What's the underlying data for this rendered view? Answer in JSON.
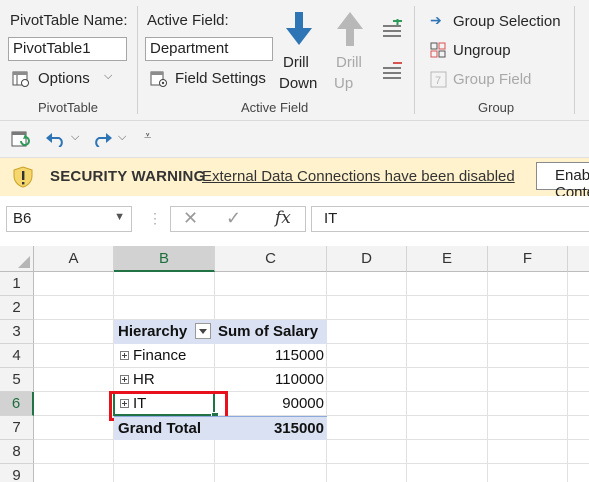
{
  "ribbon": {
    "pivot_name_label": "PivotTable Name:",
    "pivot_name_value": "PivotTable1",
    "options_label": "Options",
    "group_pivot_label": "PivotTable",
    "active_field_label": "Active Field:",
    "active_field_value": "Department",
    "field_settings_label": "Field Settings",
    "drill_down_line1": "Drill",
    "drill_down_line2": "Down",
    "drill_up_line1": "Drill",
    "drill_up_line2": "Up",
    "group_active_label": "Active Field",
    "group_selection_label": "Group Selection",
    "ungroup_label": "Ungroup",
    "group_field_label": "Group Field",
    "group_group_label": "Group"
  },
  "security": {
    "title": "SECURITY WARNING",
    "message": "External Data Connections have been disabled",
    "enable_label": "Enable Content"
  },
  "formula_bar": {
    "name_box": "B6",
    "fx_label": "fx",
    "value": "IT"
  },
  "grid": {
    "columns": [
      "A",
      "B",
      "C",
      "D",
      "E",
      "F"
    ],
    "rows": [
      "1",
      "2",
      "3",
      "4",
      "5",
      "6",
      "7",
      "8",
      "9"
    ],
    "selected_cell": "B6"
  },
  "pivot": {
    "header_row_label": "Hierarchy",
    "header_value": "Sum of Salary",
    "rows": [
      {
        "label": "Finance",
        "value": "115000"
      },
      {
        "label": "HR",
        "value": "110000"
      },
      {
        "label": "IT",
        "value": "90000"
      }
    ],
    "grand_total_label": "Grand Total",
    "grand_total_value": "315000"
  },
  "colors": {
    "excel_green": "#217346",
    "pivot_header_bg": "#d9e1f2",
    "highlight_red": "#e8101a",
    "drill_blue": "#2e75b6",
    "security_bg": "#fff2cc"
  }
}
